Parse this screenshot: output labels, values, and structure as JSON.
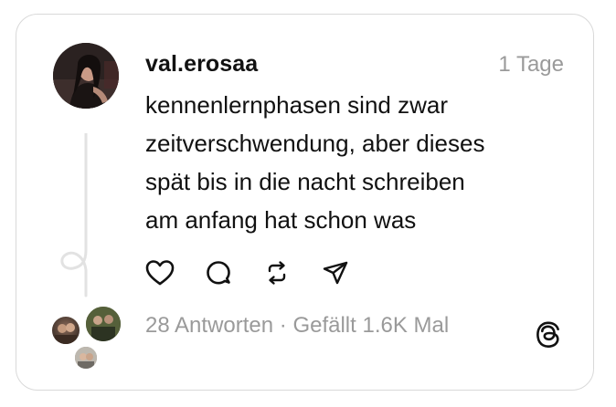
{
  "post": {
    "username": "val.erosaa",
    "timestamp": "1 Tage",
    "text_lines": [
      "kennenlernphasen sind zwar",
      "zeitverschwendung, aber dieses",
      "spät bis in die nacht schreiben",
      "am anfang hat schon was"
    ]
  },
  "actions": [
    {
      "name": "like",
      "icon": "heart-icon"
    },
    {
      "name": "reply",
      "icon": "comment-bubble-icon"
    },
    {
      "name": "repost",
      "icon": "repost-icon"
    },
    {
      "name": "share",
      "icon": "send-icon"
    }
  ],
  "stats": {
    "replies": "28 Antworten",
    "separator": " · ",
    "likes": "Gefällt 1.6K Mal"
  },
  "brand": {
    "logo": "threads-logo-icon"
  },
  "colors": {
    "text": "#111111",
    "muted": "#9a9a9a",
    "border": "#d9d9d9",
    "thread_line": "#e2e2e2"
  }
}
